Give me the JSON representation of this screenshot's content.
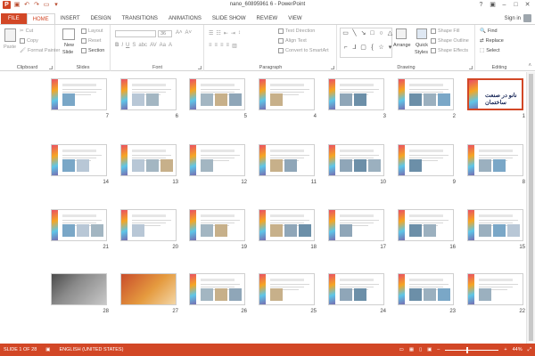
{
  "window": {
    "title": "nano_60895961 6 - PowerPoint"
  },
  "tabs": [
    "FILE",
    "HOME",
    "INSERT",
    "DESIGN",
    "TRANSITIONS",
    "ANIMATIONS",
    "SLIDE SHOW",
    "REVIEW",
    "VIEW"
  ],
  "active_tab": "HOME",
  "account": {
    "signin": "Sign in"
  },
  "ribbon": {
    "clipboard": {
      "label": "Clipboard",
      "paste": "Paste",
      "cut": "Cut",
      "copy": "Copy",
      "format_painter": "Format Painter"
    },
    "slides": {
      "label": "Slides",
      "new_slide": "New",
      "new_slide2": "Slide",
      "layout": "Layout",
      "reset": "Reset",
      "section": "Section"
    },
    "font": {
      "label": "Font",
      "size": "36"
    },
    "paragraph": {
      "label": "Paragraph",
      "text_direction": "Text Direction",
      "align_text": "Align Text",
      "convert": "Convert to SmartArt"
    },
    "drawing": {
      "label": "Drawing",
      "arrange": "Arrange",
      "quick_styles": "Quick",
      "quick_styles2": "Styles",
      "shape_fill": "Shape Fill",
      "shape_outline": "Shape Outline",
      "shape_effects": "Shape Effects"
    },
    "editing": {
      "label": "Editing",
      "find": "Find",
      "replace": "Replace",
      "select": "Select"
    }
  },
  "slides": [
    {
      "n": "7"
    },
    {
      "n": "6"
    },
    {
      "n": "5"
    },
    {
      "n": "4"
    },
    {
      "n": "3"
    },
    {
      "n": "2"
    },
    {
      "n": "1"
    },
    {
      "n": "14"
    },
    {
      "n": "13"
    },
    {
      "n": "12"
    },
    {
      "n": "11"
    },
    {
      "n": "10"
    },
    {
      "n": "9"
    },
    {
      "n": "8"
    },
    {
      "n": "21"
    },
    {
      "n": "20"
    },
    {
      "n": "19"
    },
    {
      "n": "18"
    },
    {
      "n": "17"
    },
    {
      "n": "16"
    },
    {
      "n": "15"
    },
    {
      "n": "28"
    },
    {
      "n": "27"
    },
    {
      "n": "26"
    },
    {
      "n": "25"
    },
    {
      "n": "24"
    },
    {
      "n": "23"
    },
    {
      "n": "22"
    }
  ],
  "title_slide_text": "نانو در صنعت ساختمان",
  "status": {
    "slide_info": "SLIDE 1 OF 28",
    "language": "ENGLISH (UNITED STATES)",
    "zoom": "44%"
  },
  "colors": {
    "accent": "#d24726"
  }
}
